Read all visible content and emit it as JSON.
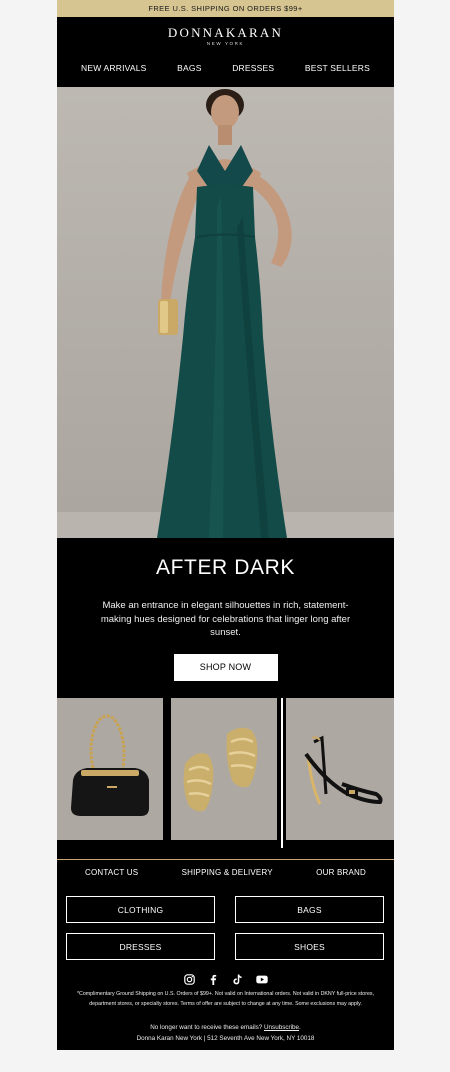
{
  "promo_bar": {
    "text": "FREE U.S. SHIPPING ON ORDERS $99+"
  },
  "logo": {
    "main": "DONNAKARAN",
    "sub": "NEW YORK"
  },
  "nav": [
    {
      "label": "NEW ARRIVALS"
    },
    {
      "label": "BAGS"
    },
    {
      "label": "DRESSES"
    },
    {
      "label": "BEST SELLERS"
    }
  ],
  "hero": {
    "title": "AFTER DARK",
    "body": "Make an entrance in elegant silhouettes in rich, statement-making hues designed for celebrations that linger long after sunset.",
    "cta": "SHOP NOW"
  },
  "footer": {
    "links": [
      {
        "label": "CONTACT US"
      },
      {
        "label": "SHIPPING & DELIVERY"
      },
      {
        "label": "OUR BRAND"
      }
    ],
    "categories": [
      {
        "label": "CLOTHING"
      },
      {
        "label": "BAGS"
      },
      {
        "label": "DRESSES"
      },
      {
        "label": "SHOES"
      }
    ],
    "social_icons": [
      "instagram-icon",
      "facebook-icon",
      "tiktok-icon",
      "youtube-icon"
    ],
    "fineprint": "*Complimentary Ground Shipping on U.S. Orders of $99+. Not valid on International orders. Not valid in DKNY full-price stores, department stores, or specialty stores. Terms of offer are subject to change at any time. Some exclusions may apply.",
    "unsubscribe_prefix": "No longer want to receive these emails?",
    "unsubscribe_link": "Unsubscribe",
    "unsubscribe_suffix": ".",
    "address": "Donna Karan New York | 512 Seventh Ave New York, NY 10018"
  },
  "colors": {
    "promo_bar": "#d6c491",
    "background": "#000000",
    "accent_line": "#c4a86e",
    "dress": "#134b48"
  }
}
